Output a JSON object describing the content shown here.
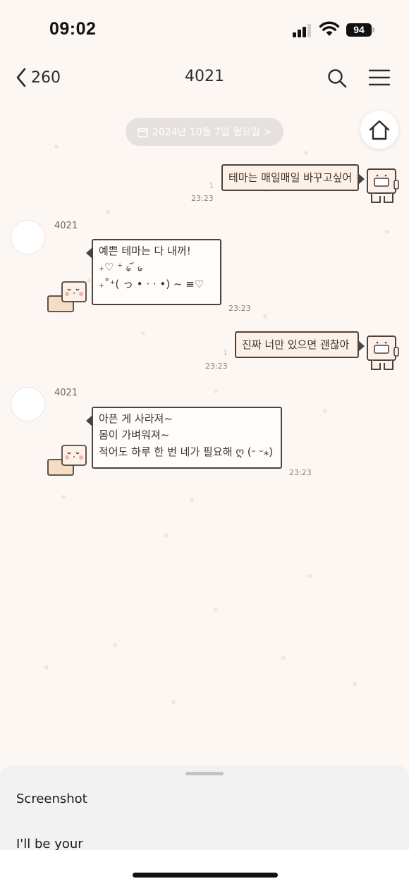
{
  "status_bar": {
    "time": "09:02",
    "battery": "94"
  },
  "nav": {
    "back_label": "260",
    "title": "4021"
  },
  "date_divider": "2024년 10월 7일 월요일 >",
  "messages": [
    {
      "from": "me",
      "lines": [
        "테마는 매일매일 바꾸고싶어"
      ],
      "read": "1",
      "time": "23:23"
    },
    {
      "from": "4021",
      "sender": "4021",
      "lines": [
        "예쁜 테마는 다 내꺼!",
        "₊♡ ⁺  ᥀ ᷄ ᥀",
        "₊˚⁺( っ • · · •) ~ ≡♡"
      ],
      "time": "23:23"
    },
    {
      "from": "me",
      "lines": [
        "진짜 너만 있으면 괜찮아"
      ],
      "read": "1",
      "time": "23:23"
    },
    {
      "from": "4021",
      "sender": "4021",
      "lines": [
        "아픈 게 사라져~",
        "몸이 가벼워져~",
        "적어도 하루 한 번 네가 필요해 ღ (ᵕ ᵕ⁎)"
      ],
      "time": "23:23"
    }
  ],
  "bottom_sheet": {
    "items": [
      "Screenshot",
      "I'll be your"
    ]
  },
  "icons": [
    "chevron-left-icon",
    "search-icon",
    "menu-icon",
    "calendar-icon",
    "home-icon",
    "wifi-icon",
    "signal-icon"
  ],
  "colors": {
    "background": "#fdf7f3",
    "bubble_border": "#4a4340",
    "date_pill": "#e6e1de"
  }
}
